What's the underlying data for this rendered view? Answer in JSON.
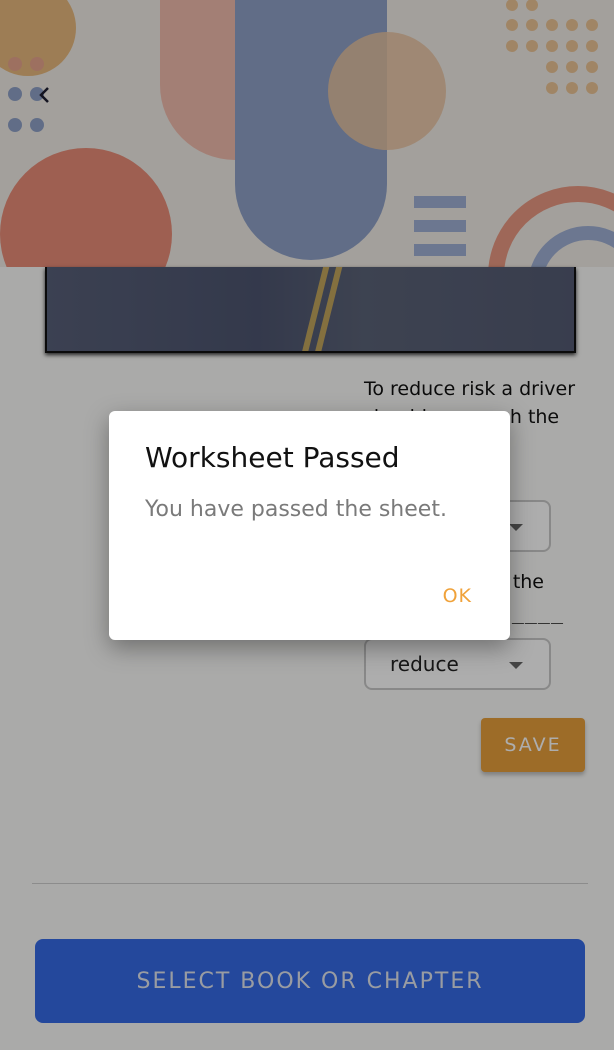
{
  "header": {
    "back_icon": "chevron-left-icon"
  },
  "question1": {
    "text": "To reduce risk a driver should approach the",
    "selected_value": ""
  },
  "question2": {
    "text": "the",
    "blank": "____",
    "selected_value": "reduce"
  },
  "save_label": "SAVE",
  "select_book_label": "SELECT BOOK OR CHAPTER",
  "dialog": {
    "title": "Worksheet Passed",
    "message": "You have passed the sheet.",
    "ok_label": "OK"
  },
  "colors": {
    "accent": "#e7a03c",
    "primary": "#356ae6",
    "ok": "#f0a23a"
  }
}
